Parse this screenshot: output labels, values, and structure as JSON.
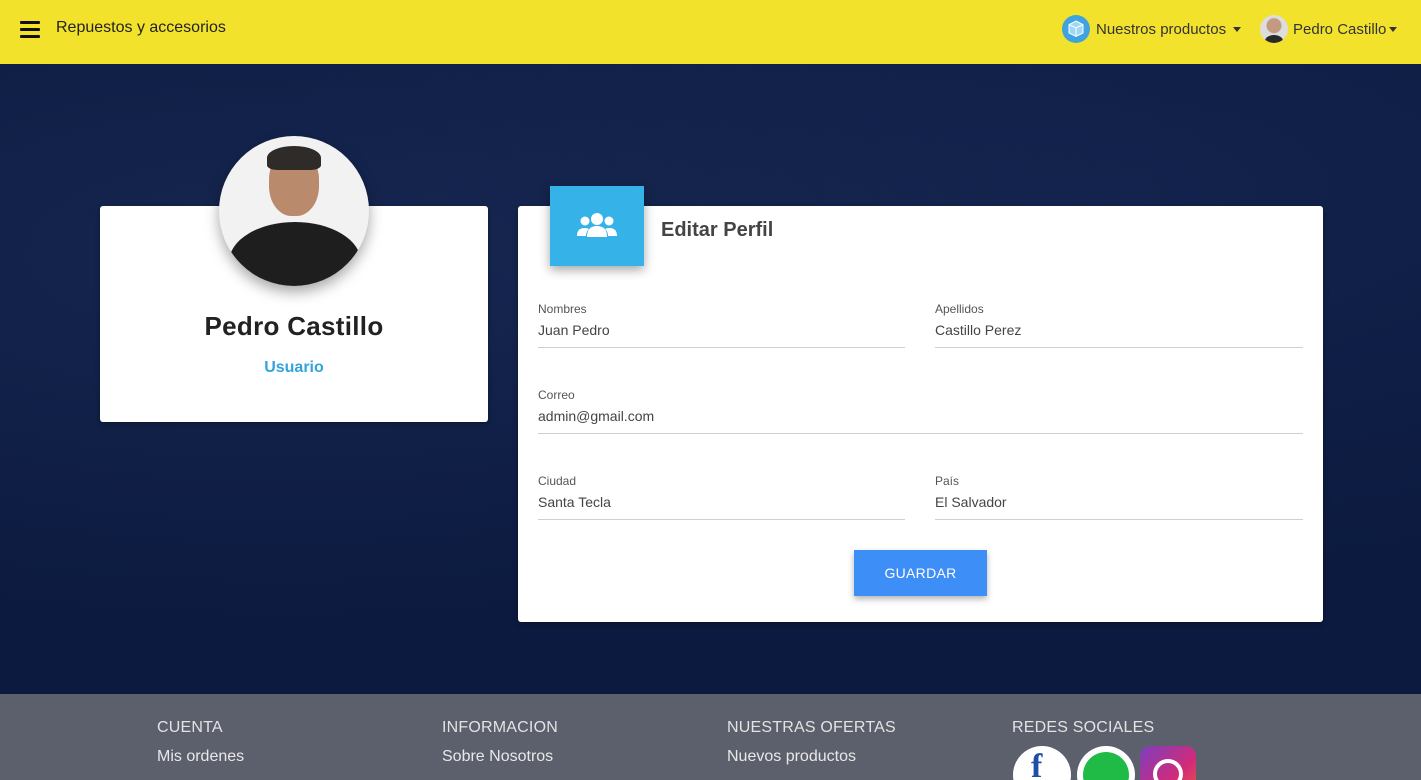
{
  "navbar": {
    "brand": "Repuestos y accesorios",
    "products_label": "Nuestros productos",
    "user_label": "Pedro Castillo",
    "bg_color": "#f3e22c"
  },
  "profile": {
    "name": "Pedro Castillo",
    "role": "Usuario"
  },
  "edit_form": {
    "title": "Editar Perfil",
    "fields": {
      "nombres": {
        "label": "Nombres",
        "value": "Juan Pedro"
      },
      "apellidos": {
        "label": "Apellidos",
        "value": "Castillo Perez"
      },
      "correo": {
        "label": "Correo",
        "value": "admin@gmail.com"
      },
      "ciudad": {
        "label": "Ciudad",
        "value": "Santa Tecla"
      },
      "pais": {
        "label": "País",
        "value": "El Salvador"
      }
    },
    "save_label": "GUARDAR"
  },
  "footer": {
    "columns": [
      {
        "title": "CUENTA",
        "link": "Mis ordenes"
      },
      {
        "title": "INFORMACION",
        "link": "Sobre Nosotros"
      },
      {
        "title": "NUESTRAS OFERTAS",
        "link": "Nuevos productos"
      },
      {
        "title": "REDES SOCIALES"
      }
    ],
    "social_icons": [
      "facebook-icon",
      "whatsapp-icon",
      "instagram-icon"
    ]
  },
  "colors": {
    "accent": "#35b2e8",
    "button": "#3e8ef7",
    "page_bg": "#0c1a3f",
    "footer_bg": "#5c606c"
  }
}
